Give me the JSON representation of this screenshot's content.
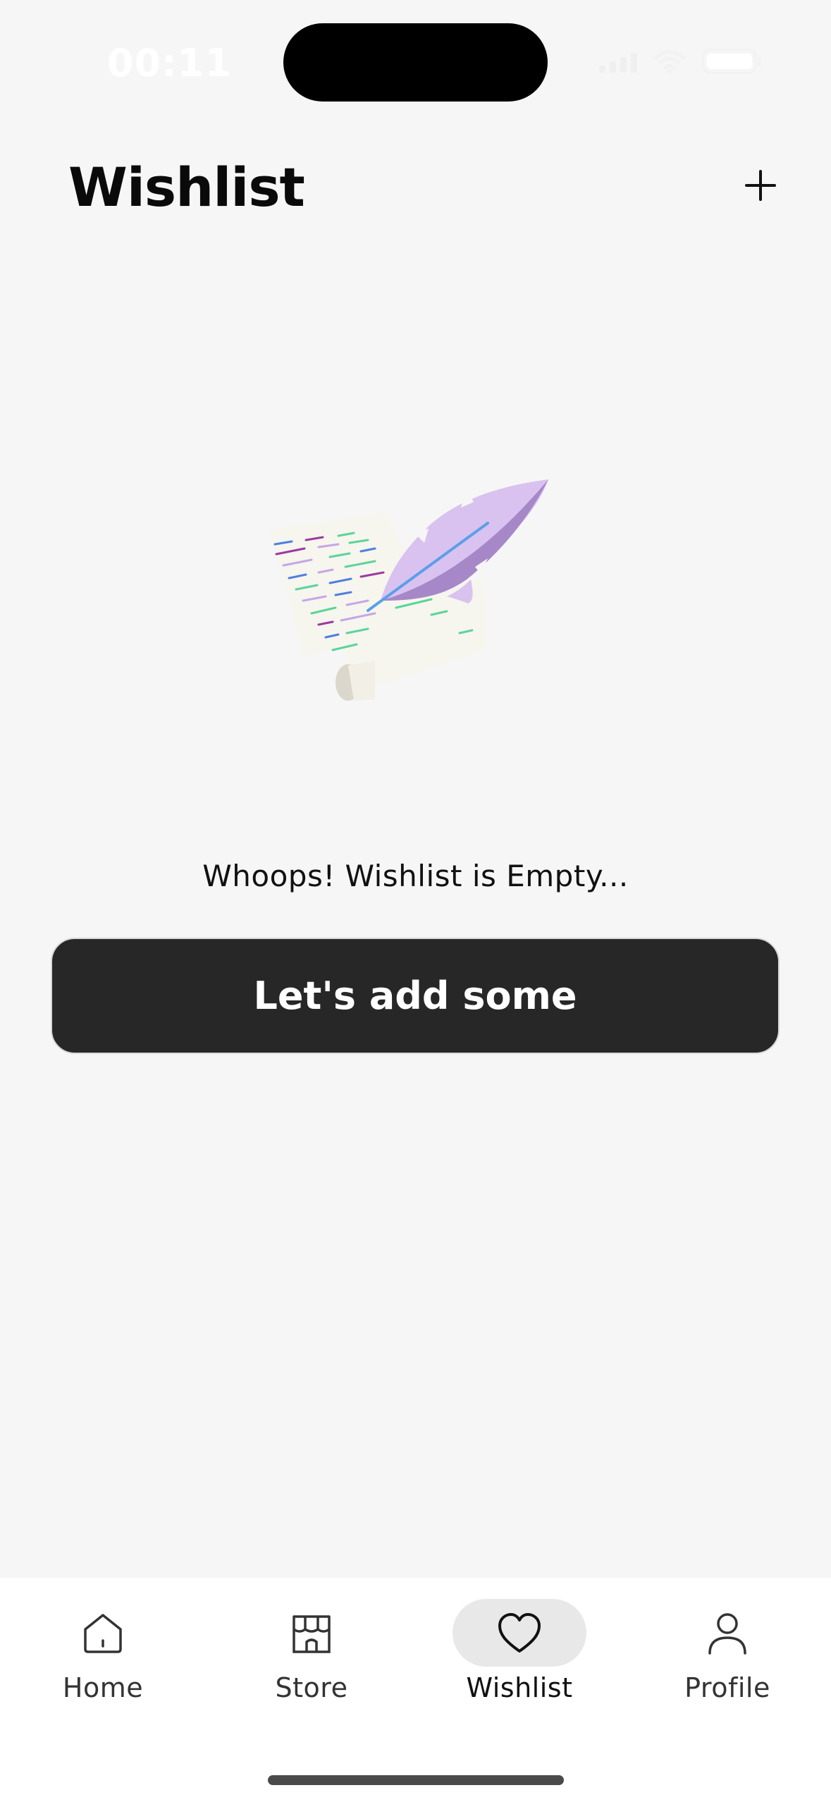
{
  "status_bar": {
    "time": "00:11"
  },
  "header": {
    "title": "Wishlist",
    "add_icon": "plus-icon"
  },
  "empty_state": {
    "illustration": "quill-and-scroll-illustration",
    "message": "Whoops! Wishlist is Empty...",
    "cta_label": "Let's add some"
  },
  "tab_bar": {
    "active": "Wishlist",
    "tabs": [
      {
        "label": "Home",
        "icon": "home-icon"
      },
      {
        "label": "Store",
        "icon": "store-icon"
      },
      {
        "label": "Wishlist",
        "icon": "heart-icon"
      },
      {
        "label": "Profile",
        "icon": "user-icon"
      }
    ]
  },
  "colors": {
    "background": "#f6f6f6",
    "button": "#272727",
    "active_tab_pill": "#e8e8e8",
    "tab_bar": "#ffffff"
  }
}
